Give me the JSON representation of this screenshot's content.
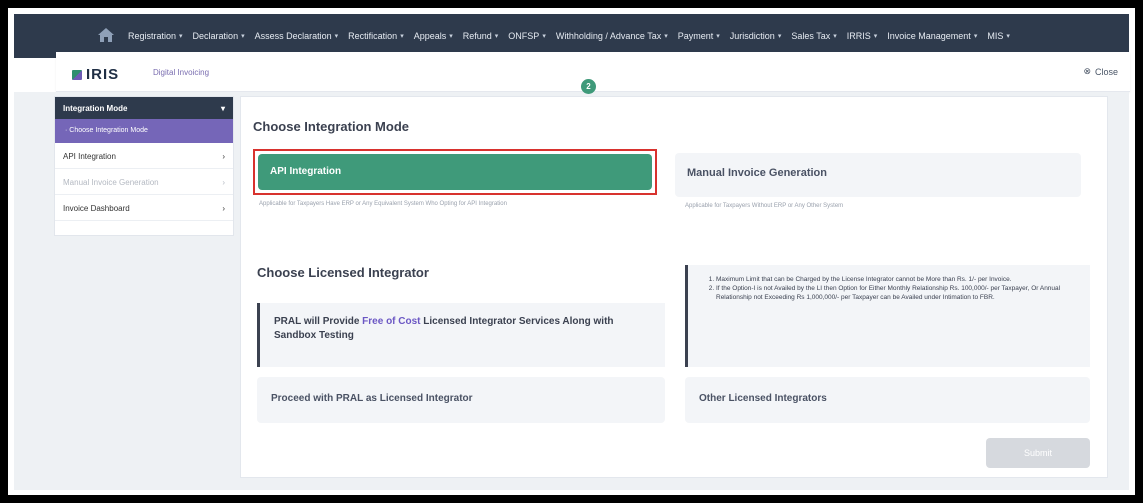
{
  "nav": {
    "items": [
      "Registration",
      "Declaration",
      "Assess Declaration",
      "Rectification",
      "Appeals",
      "Refund",
      "ONFSP",
      "Withholding / Advance Tax",
      "Payment",
      "Jurisdiction",
      "Sales Tax",
      "IRRIS",
      "Invoice Management",
      "MIS"
    ]
  },
  "header": {
    "logo_text": "IRIS",
    "subtitle": "Digital Invoicing",
    "close_label": "Close",
    "step_number": "2"
  },
  "sidebar": {
    "section_label": "Integration Mode",
    "active_item": "Choose Integration Mode",
    "items": [
      {
        "label": "API Integration",
        "disabled": false
      },
      {
        "label": "Manual Invoice Generation",
        "disabled": true
      },
      {
        "label": "Invoice Dashboard",
        "disabled": false
      }
    ]
  },
  "integration": {
    "heading": "Choose Integration Mode",
    "api_label": "API Integration",
    "api_hint": "Applicable for Taxpayers Have ERP or Any Equivalent System Who Opting for API Integration",
    "manual_label": "Manual Invoice Generation",
    "manual_hint": "Applicable for Taxpayers Without ERP or Any Other System"
  },
  "licensed": {
    "heading": "Choose Licensed Integrator",
    "pral_text_before": "PRAL will Provide",
    "pral_text_highlight": "Free of Cost",
    "pral_text_after": "Licensed Integrator Services Along with Sandbox Testing",
    "info_points": [
      "Maximum Limit that can be Charged by the License Integrator cannot be More than Rs. 1/- per Invoice.",
      "If the Option-I is not Availed by the LI then Option for Either Monthly Relationship Rs. 100,000/- per Taxpayer, Or Annual Relationship not Exceeding Rs 1,000,000/- per Taxpayer can be Availed under Intimation to FBR."
    ],
    "proceed_label": "Proceed with PRAL as Licensed Integrator",
    "other_label": "Other Licensed Integrators",
    "submit_label": "Submit"
  },
  "colors": {
    "nav_bg": "#2e3a4c",
    "accent_green": "#3f9a7a",
    "accent_purple": "#7566b8",
    "highlight_red": "#d8322e"
  }
}
